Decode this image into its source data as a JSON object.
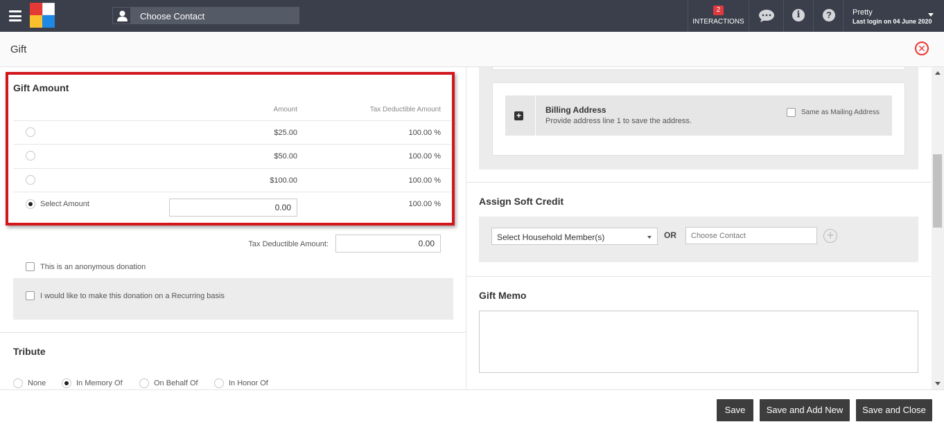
{
  "topbar": {
    "menu_icon": "hamburger-icon",
    "contact_placeholder": "Choose Contact",
    "interactions_count": "2",
    "interactions_label": "INTERACTIONS",
    "user_name": "Pretty",
    "last_login": "Last login on 04 June 2020",
    "colors": {
      "bar": "#3a3f4b",
      "badge": "#e0393e"
    }
  },
  "header": {
    "title": "Gift"
  },
  "gift_amount": {
    "title": "Gift Amount",
    "col_amount": "Amount",
    "col_tax": "Tax Deductible Amount",
    "rows": [
      {
        "amount": "$25.00",
        "tax": "100.00 %"
      },
      {
        "amount": "$50.00",
        "tax": "100.00 %"
      },
      {
        "amount": "$100.00",
        "tax": "100.00 %"
      }
    ],
    "select_label": "Select Amount",
    "select_value": "0.00",
    "select_tax": "100.00 %",
    "highlight_color": "#d2161c"
  },
  "tax_deductible": {
    "label": "Tax Deductible Amount:",
    "value": "0.00"
  },
  "anonymous_label": "This is an anonymous donation",
  "recurring_label": "I would like to make this donation on a Recurring basis",
  "tribute": {
    "title": "Tribute",
    "options": [
      "None",
      "In Memory Of",
      "On Behalf Of",
      "In Honor Of"
    ],
    "selected": "In Memory Of"
  },
  "billing": {
    "title": "Billing Address",
    "subtitle": "Provide address line 1 to save the address.",
    "same_as_label": "Same as Mailing Address"
  },
  "soft_credit": {
    "title": "Assign Soft Credit",
    "household_placeholder": "Select Household Member(s)",
    "or_label": "OR",
    "contact_placeholder": "Choose Contact"
  },
  "gift_memo": {
    "title": "Gift Memo"
  },
  "footer": {
    "save": "Save",
    "save_add_new": "Save and Add New",
    "save_close": "Save and Close"
  }
}
